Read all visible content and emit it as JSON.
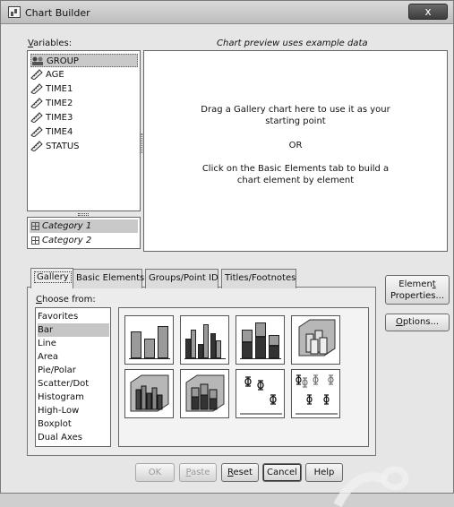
{
  "window": {
    "title": "Chart Builder",
    "close_label": "x"
  },
  "variables": {
    "label": "Variables:",
    "items": [
      {
        "name": "GROUP",
        "icon": "nominal-icon"
      },
      {
        "name": "AGE",
        "icon": "scale-ruler-icon"
      },
      {
        "name": "TIME1",
        "icon": "scale-ruler-icon"
      },
      {
        "name": "TIME2",
        "icon": "scale-ruler-icon"
      },
      {
        "name": "TIME3",
        "icon": "scale-ruler-icon"
      },
      {
        "name": "TIME4",
        "icon": "scale-ruler-icon"
      },
      {
        "name": "STATUS",
        "icon": "scale-ruler-icon"
      }
    ],
    "selected": "GROUP"
  },
  "categories": {
    "items": [
      "Category 1",
      "Category 2"
    ],
    "selected": "Category 1"
  },
  "preview": {
    "header": "Chart preview uses example data",
    "line1": "Drag a Gallery chart here to use it as your",
    "line2": "starting point",
    "or": "OR",
    "line3": "Click on the Basic Elements tab to build a",
    "line4": "chart element by element"
  },
  "tabs": [
    {
      "label": "Gallery",
      "active": true
    },
    {
      "label": "Basic Elements",
      "active": false
    },
    {
      "label": "Groups/Point ID",
      "active": false
    },
    {
      "label": "Titles/Footnotes",
      "active": false
    }
  ],
  "gallery": {
    "choose_label": "Choose from:",
    "items": [
      "Favorites",
      "Bar",
      "Line",
      "Area",
      "Pie/Polar",
      "Scatter/Dot",
      "Histogram",
      "High-Low",
      "Boxplot",
      "Dual Axes"
    ],
    "selected": "Bar",
    "thumbnails": [
      "simple-bar-chart-icon",
      "clustered-bar-chart-icon",
      "stacked-bar-chart-icon",
      "3d-simple-bar-icon",
      "3d-clustered-bar-icon",
      "3d-stacked-bar-icon",
      "error-bar-icon",
      "clustered-error-bar-icon"
    ]
  },
  "side_buttons": {
    "element_properties_line1": "Element",
    "element_properties_line2": "Properties...",
    "options": "Options..."
  },
  "buttons": {
    "ok": "OK",
    "paste": "Paste",
    "reset": "Reset",
    "cancel": "Cancel",
    "help": "Help"
  },
  "colors": {
    "bar_gray": "#9a9a9a",
    "bar_dark": "#333333",
    "selection": "#c6c6c6"
  }
}
